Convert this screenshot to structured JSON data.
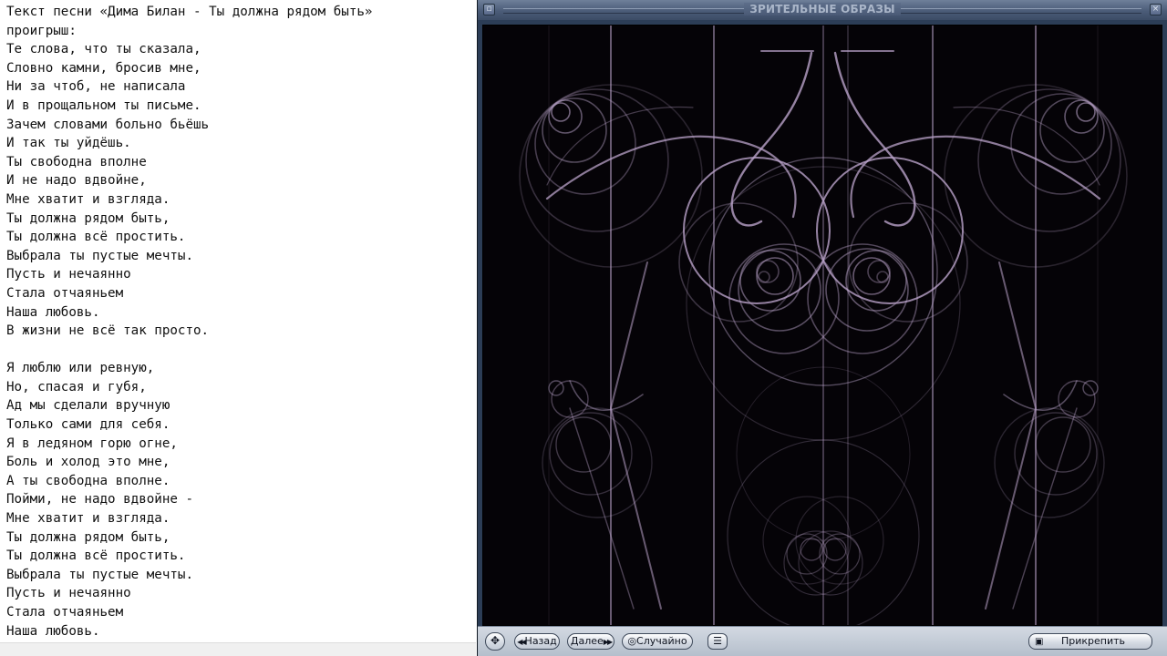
{
  "lyrics": {
    "lines": [
      "Текст песни «Дима Билан - Ты должна рядом быть»",
      "проигрыш:",
      "Те слова, что ты сказала,",
      "Словно камни, бросив мне,",
      "Ни за чтоб, не написала",
      "И в прощальном ты письме.",
      "Зачем словами больно бьёшь",
      "И так ты уйдёшь.",
      "Ты свободна вполне",
      "И не надо вдвойне,",
      "Мне хватит и взгляда.",
      "Ты должна рядом быть,",
      "Ты должна всё простить.",
      "Выбрала ты пустые мечты.",
      "Пусть и нечаянно",
      "Стала отчаяньем",
      "Наша любовь.",
      "В жизни не всё так просто.",
      "",
      "Я люблю или ревную,",
      "Но, спасая и губя,",
      "Ад мы сделали вручную",
      "Только сами для себя.",
      "Я в ледяном горю огне,",
      "Боль и холод это мне,",
      "А ты свободна вполне.",
      "Пойми, не надо вдвойне -",
      "Мне хватит и взгляда.",
      "Ты должна рядом быть,",
      "Ты должна всё простить.",
      "Выбрала ты пустые мечты.",
      "Пусть и нечаянно",
      "Стала отчаяньем",
      "Наша любовь."
    ]
  },
  "player": {
    "title": "ЗРИТЕЛЬНЫЕ ОБРАЗЫ",
    "controls": {
      "move_glyph": "✥",
      "prev_label": "Назад",
      "next_label": "Далее",
      "random_label": "Случайно",
      "random_glyph": "◎",
      "options_glyph": "☰",
      "dock_label": "Прикрепить",
      "dock_glyph": "▣"
    },
    "colors": {
      "frame": "#2c3d56",
      "canvas": "#050307",
      "stroke": "#b9a3c9"
    }
  }
}
